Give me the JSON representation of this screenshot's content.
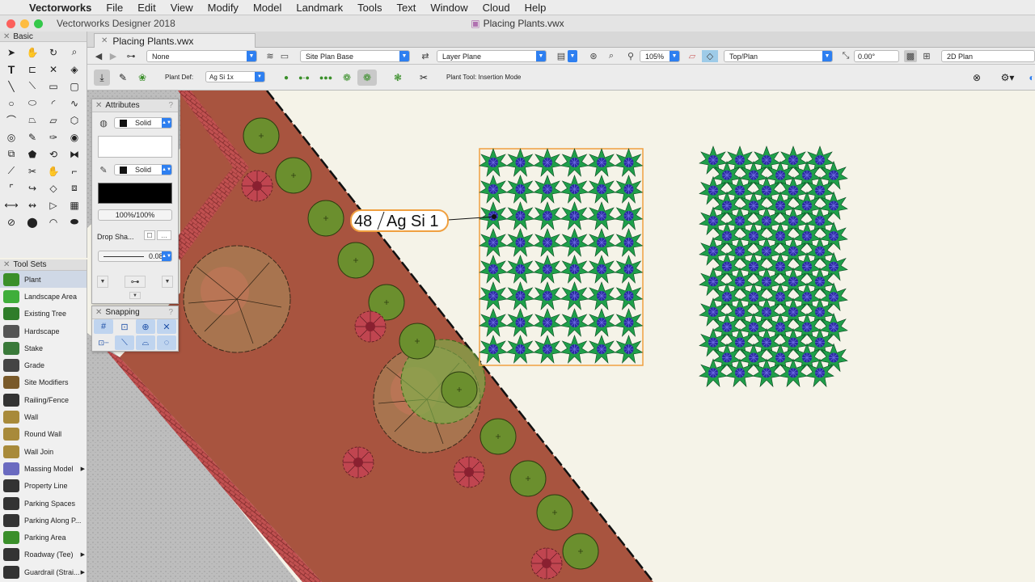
{
  "menubar": {
    "app": "Vectorworks",
    "items": [
      "File",
      "Edit",
      "View",
      "Modify",
      "Model",
      "Landmark",
      "Tools",
      "Text",
      "Window",
      "Cloud",
      "Help"
    ]
  },
  "window": {
    "app_title": "Vectorworks Designer 2018",
    "doc_title": "Placing Plants.vwx"
  },
  "basic_palette": {
    "title": "Basic"
  },
  "tab": {
    "label": "Placing Plants.vwx"
  },
  "viewbar": {
    "class": "None",
    "layer": "Site Plan Base",
    "layer_plane": "Layer Plane",
    "zoom": "105%",
    "view": "Top/Plan",
    "rotation": "0.00°",
    "render": "2D Plan"
  },
  "toolbar": {
    "plant_def_label": "Plant Def:",
    "plant_def_value": "Ag Si 1x",
    "mode_text": "Plant Tool: Insertion Mode"
  },
  "attributes": {
    "title": "Attributes",
    "fill_style": "Solid",
    "pen_style": "Solid",
    "opacity": "100%/100%",
    "drop_shadow": "Drop Sha...",
    "line_weight": "0.08"
  },
  "snapping": {
    "title": "Snapping"
  },
  "toolsets": {
    "title": "Tool Sets",
    "items": [
      {
        "label": "Plant",
        "icon": "plant-icon",
        "color": "#3a8f2a"
      },
      {
        "label": "Landscape Area",
        "icon": "landscape-area-icon",
        "color": "#3fae3a"
      },
      {
        "label": "Existing Tree",
        "icon": "existing-tree-icon",
        "color": "#2f7d2a"
      },
      {
        "label": "Hardscape",
        "icon": "hardscape-icon",
        "color": "#555555"
      },
      {
        "label": "Stake",
        "icon": "stake-icon",
        "color": "#3a7a3a"
      },
      {
        "label": "Grade",
        "icon": "grade-icon",
        "color": "#444444"
      },
      {
        "label": "Site Modifiers",
        "icon": "site-modifiers-icon",
        "color": "#7a5a2a"
      },
      {
        "label": "Railing/Fence",
        "icon": "railing-fence-icon",
        "color": "#333333"
      },
      {
        "label": "Wall",
        "icon": "wall-icon",
        "color": "#a88a3a"
      },
      {
        "label": "Round Wall",
        "icon": "round-wall-icon",
        "color": "#a88a3a"
      },
      {
        "label": "Wall Join",
        "icon": "wall-join-icon",
        "color": "#a88a3a"
      },
      {
        "label": "Massing Model",
        "icon": "massing-model-icon",
        "color": "#6a6ac0",
        "submenu": true
      },
      {
        "label": "Property Line",
        "icon": "property-line-icon",
        "color": "#333333"
      },
      {
        "label": "Parking Spaces",
        "icon": "parking-spaces-icon",
        "color": "#333333"
      },
      {
        "label": "Parking Along P...",
        "icon": "parking-along-path-icon",
        "color": "#333333"
      },
      {
        "label": "Parking Area",
        "icon": "parking-area-icon",
        "color": "#3a8f2a"
      },
      {
        "label": "Roadway (Tee)",
        "icon": "roadway-tee-icon",
        "color": "#333333",
        "submenu": true
      },
      {
        "label": "Guardrail (Strai...",
        "icon": "guardrail-icon",
        "color": "#333333",
        "submenu": true
      }
    ]
  },
  "canvas": {
    "plant_tag": {
      "count": "48",
      "code": "Ag Si 1"
    },
    "colors": {
      "paving": "#a8543f",
      "brick": "#b24a4a",
      "gravel": "#bdbdbd",
      "lawn": "#f5f3e8",
      "shrub": "#6b8f2e",
      "plant": "#1f9f4a",
      "plant_center": "#2a2aa0",
      "selection": "#f0a040"
    }
  }
}
